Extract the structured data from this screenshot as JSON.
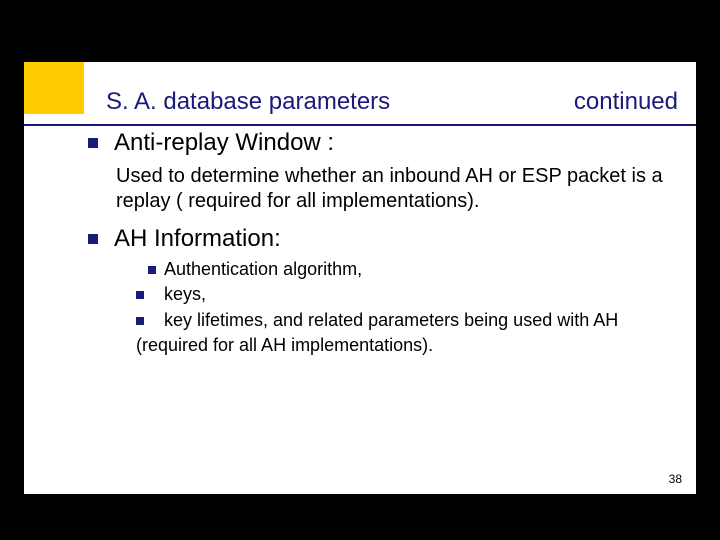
{
  "title_left": "S. A. database parameters",
  "title_right": "continued",
  "items": [
    {
      "heading": "Anti-replay Window :",
      "body": "Used to determine whether an inbound AH or ESP packet is a replay ( required for all implementations)."
    },
    {
      "heading": "AH Information:",
      "subitems": [
        " Authentication algorithm,",
        "keys,",
        "key lifetimes, and related parameters being used with AH"
      ],
      "subfooter": "(required for all AH implementations)."
    }
  ],
  "page_number": "38"
}
